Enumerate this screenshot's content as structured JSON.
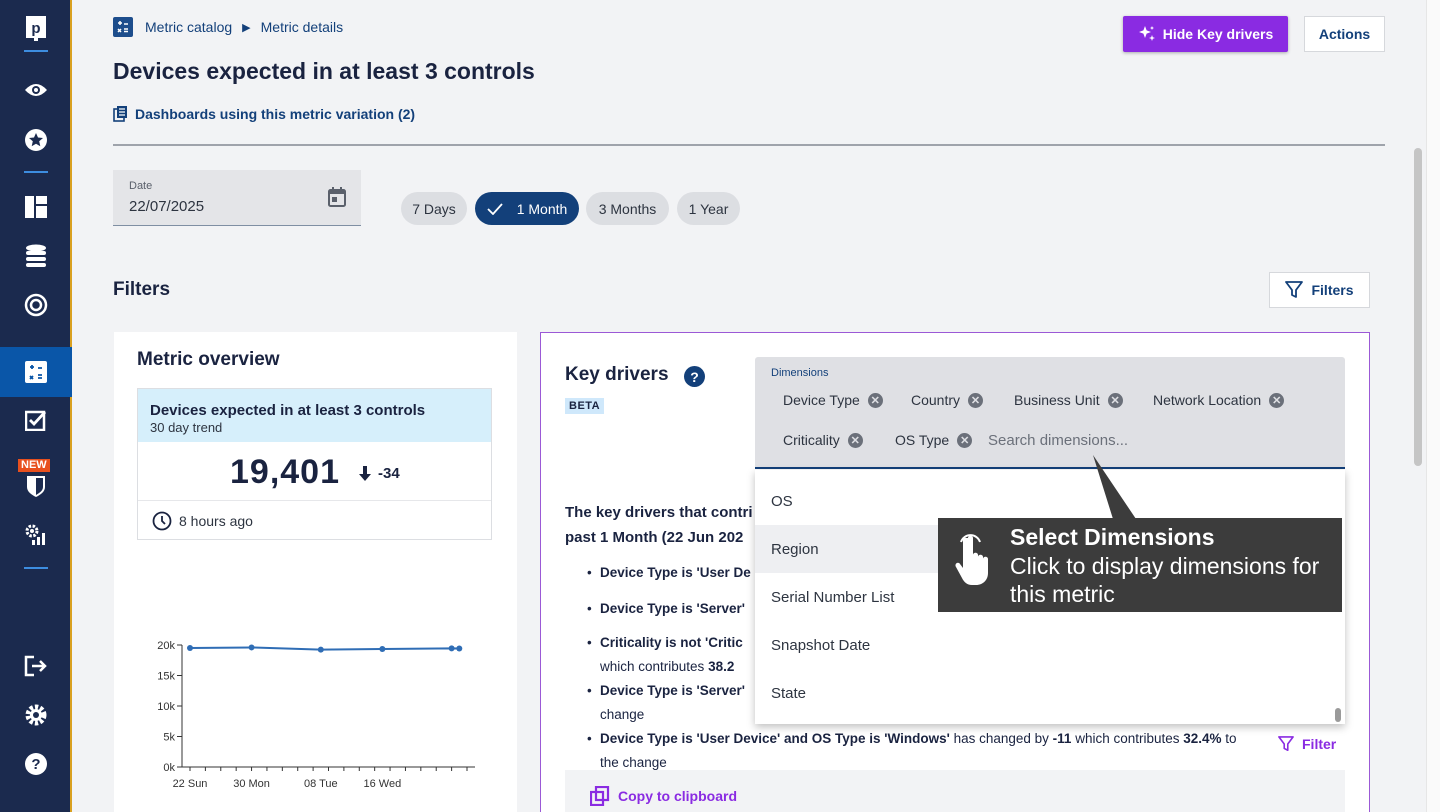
{
  "sidebar": {
    "items": [
      {
        "name": "logo-icon"
      },
      {
        "name": "eye-icon"
      },
      {
        "name": "star-icon"
      },
      {
        "name": "dashboard-icon"
      },
      {
        "name": "database-icon"
      },
      {
        "name": "target-icon"
      },
      {
        "name": "metric-catalog-icon"
      },
      {
        "name": "checklist-icon"
      },
      {
        "name": "shield-icon"
      },
      {
        "name": "settings-chart-icon"
      },
      {
        "name": "logout-icon"
      },
      {
        "name": "gear-icon"
      },
      {
        "name": "help-icon"
      }
    ],
    "new_badge": "NEW",
    "accent_color": "#0a56a8"
  },
  "breadcrumb": {
    "root": "Metric catalog",
    "separator": "▶",
    "current": "Metric details"
  },
  "page": {
    "title": "Devices expected in at least 3 controls",
    "dashboards_link": "Dashboards using this metric variation (2)"
  },
  "header_buttons": {
    "hide_key_drivers": "Hide Key drivers",
    "actions": "Actions"
  },
  "date": {
    "label": "Date",
    "value": "22/07/2025"
  },
  "ranges": [
    {
      "label": "7 Days",
      "selected": false
    },
    {
      "label": "1 Month",
      "selected": true
    },
    {
      "label": "3 Months",
      "selected": false
    },
    {
      "label": "1 Year",
      "selected": false
    }
  ],
  "filters": {
    "heading": "Filters",
    "button": "Filters"
  },
  "overview": {
    "heading": "Metric overview",
    "kpi_title": "Devices expected in at least 3 controls",
    "kpi_subtitle": "30 day trend",
    "value": "19,401",
    "delta": "-34",
    "updated": "8 hours ago"
  },
  "chart_data": {
    "type": "line",
    "x": [
      "22 Sun",
      "30 Mon",
      "08 Tue",
      "16 Wed"
    ],
    "y_ticks": [
      "0k",
      "5k",
      "10k",
      "15k",
      "20k"
    ],
    "ylim": [
      0,
      20000
    ],
    "series": [
      {
        "values": [
          19500,
          19600,
          19250,
          19350,
          19450,
          19420
        ]
      }
    ],
    "point_days": [
      0,
      8,
      17,
      25,
      34,
      35
    ],
    "color": "#2f6db5"
  },
  "key_drivers": {
    "heading": "Key drivers",
    "beta": "BETA",
    "intro_line1": "The key drivers that contri",
    "intro_line2": "past 1 Month (22 Jun 202",
    "bullets": [
      {
        "line1": "Device Type is 'User De"
      },
      {
        "line1": "Device Type is 'Server'"
      },
      {
        "line1": "Criticality is not 'Critic",
        "line2a": "which contributes ",
        "line2b": "38.2"
      },
      {
        "line1": "Device Type is 'Server'",
        "line2a": "change"
      },
      {
        "line1b": "Device Type is 'User Device' and OS Type is 'Windows'",
        "mid": " has changed by ",
        "delta": "-11",
        "mid2": " which contributes ",
        "pct": "32.4%",
        "end": " to",
        "line2a": "the change"
      }
    ],
    "filter_link": "Filter",
    "copy": "Copy to clipboard"
  },
  "dimensions": {
    "label": "Dimensions",
    "selected": [
      "Device Type",
      "Country",
      "Business Unit",
      "Network Location",
      "Criticality",
      "OS Type"
    ],
    "placeholder": "Search dimensions...",
    "options": [
      "OS",
      "Region",
      "Serial Number List",
      "Snapshot Date",
      "State"
    ],
    "hovered": "Region"
  },
  "tooltip": {
    "title": "Select Dimensions",
    "body": "Click to display dimensions for this metric"
  }
}
